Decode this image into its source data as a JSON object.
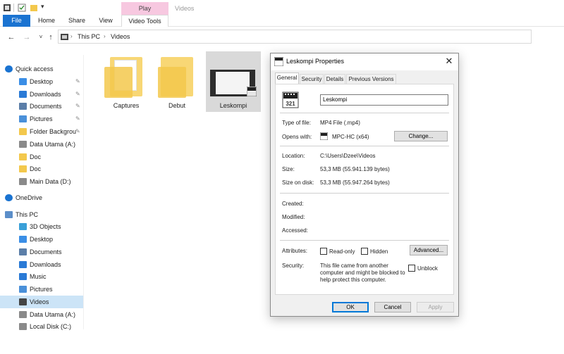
{
  "ribbon": {
    "context_tab": "Play",
    "context_title": "Videos",
    "tabs": [
      "File",
      "Home",
      "Share",
      "View",
      "Video Tools"
    ]
  },
  "address": {
    "crumbs": [
      "This PC",
      "Videos"
    ]
  },
  "sidebar": {
    "items": [
      {
        "label": "Quick access",
        "icon": "star-icon",
        "pinned": false
      },
      {
        "label": "Desktop",
        "icon": "desktop-icon",
        "pinned": true
      },
      {
        "label": "Downloads",
        "icon": "download-icon",
        "pinned": true
      },
      {
        "label": "Documents",
        "icon": "documents-icon",
        "pinned": true
      },
      {
        "label": "Pictures",
        "icon": "pictures-icon",
        "pinned": true
      },
      {
        "label": "Folder Backgrou",
        "icon": "folder-icon",
        "pinned": true
      },
      {
        "label": "Data Utama (A:)",
        "icon": "drive-icon",
        "pinned": false
      },
      {
        "label": "Doc",
        "icon": "folder-icon",
        "pinned": false
      },
      {
        "label": "Doc",
        "icon": "folder-icon",
        "pinned": false
      },
      {
        "label": "Main Data (D:)",
        "icon": "drive-icon",
        "pinned": false
      },
      {
        "label": "OneDrive",
        "icon": "cloud-icon",
        "pinned": false
      },
      {
        "label": "This PC",
        "icon": "computer-icon",
        "pinned": false
      },
      {
        "label": "3D Objects",
        "icon": "cube-icon",
        "pinned": false
      },
      {
        "label": "Desktop",
        "icon": "desktop-icon",
        "pinned": false
      },
      {
        "label": "Documents",
        "icon": "documents-icon",
        "pinned": false
      },
      {
        "label": "Downloads",
        "icon": "download-icon",
        "pinned": false
      },
      {
        "label": "Music",
        "icon": "music-icon",
        "pinned": false
      },
      {
        "label": "Pictures",
        "icon": "pictures-icon",
        "pinned": false
      },
      {
        "label": "Videos",
        "icon": "video-icon",
        "pinned": false
      },
      {
        "label": "Data Utama (A:)",
        "icon": "drive-icon",
        "pinned": false
      },
      {
        "label": "Local Disk (C:)",
        "icon": "drive-icon",
        "pinned": false
      }
    ],
    "selected_label": "Videos"
  },
  "files": [
    {
      "label": "Captures",
      "kind": "folder-with-files"
    },
    {
      "label": "Debut",
      "kind": "folder"
    },
    {
      "label": "Leskompi",
      "kind": "video"
    }
  ],
  "dialog": {
    "title": "Leskompi Properties",
    "tabs": [
      "General",
      "Security",
      "Details",
      "Previous Versions"
    ],
    "active_tab": "General",
    "name_value": "Leskompi",
    "type_label": "Type of file:",
    "type_value": "MP4 File (.mp4)",
    "opens_label": "Opens with:",
    "opens_value": "MPC-HC (x64)",
    "change_button": "Change...",
    "location_label": "Location:",
    "location_value": "C:\\Users\\Dzee\\Videos",
    "size_label": "Size:",
    "size_value": "53,3 MB (55.941.139 bytes)",
    "size_disk_label": "Size on disk:",
    "size_disk_value": "53,3 MB (55.947.264 bytes)",
    "created_label": "Created:",
    "modified_label": "Modified:",
    "accessed_label": "Accessed:",
    "attributes_label": "Attributes:",
    "readonly_label": "Read-only",
    "hidden_label": "Hidden",
    "advanced_button": "Advanced...",
    "security_label": "Security:",
    "security_text_1": "This file came from another",
    "security_text_2": "computer and might be blocked to",
    "security_text_3": "help protect this computer.",
    "unblock_label": "Unblock",
    "ok_button": "OK",
    "cancel_button": "Cancel",
    "apply_button": "Apply",
    "app_icon_text": "321"
  },
  "colors": {
    "accent": "#1a73d1",
    "context_tab": "#f7c8e0",
    "folder": "#f3c84c",
    "selection": "#cce4f7"
  }
}
